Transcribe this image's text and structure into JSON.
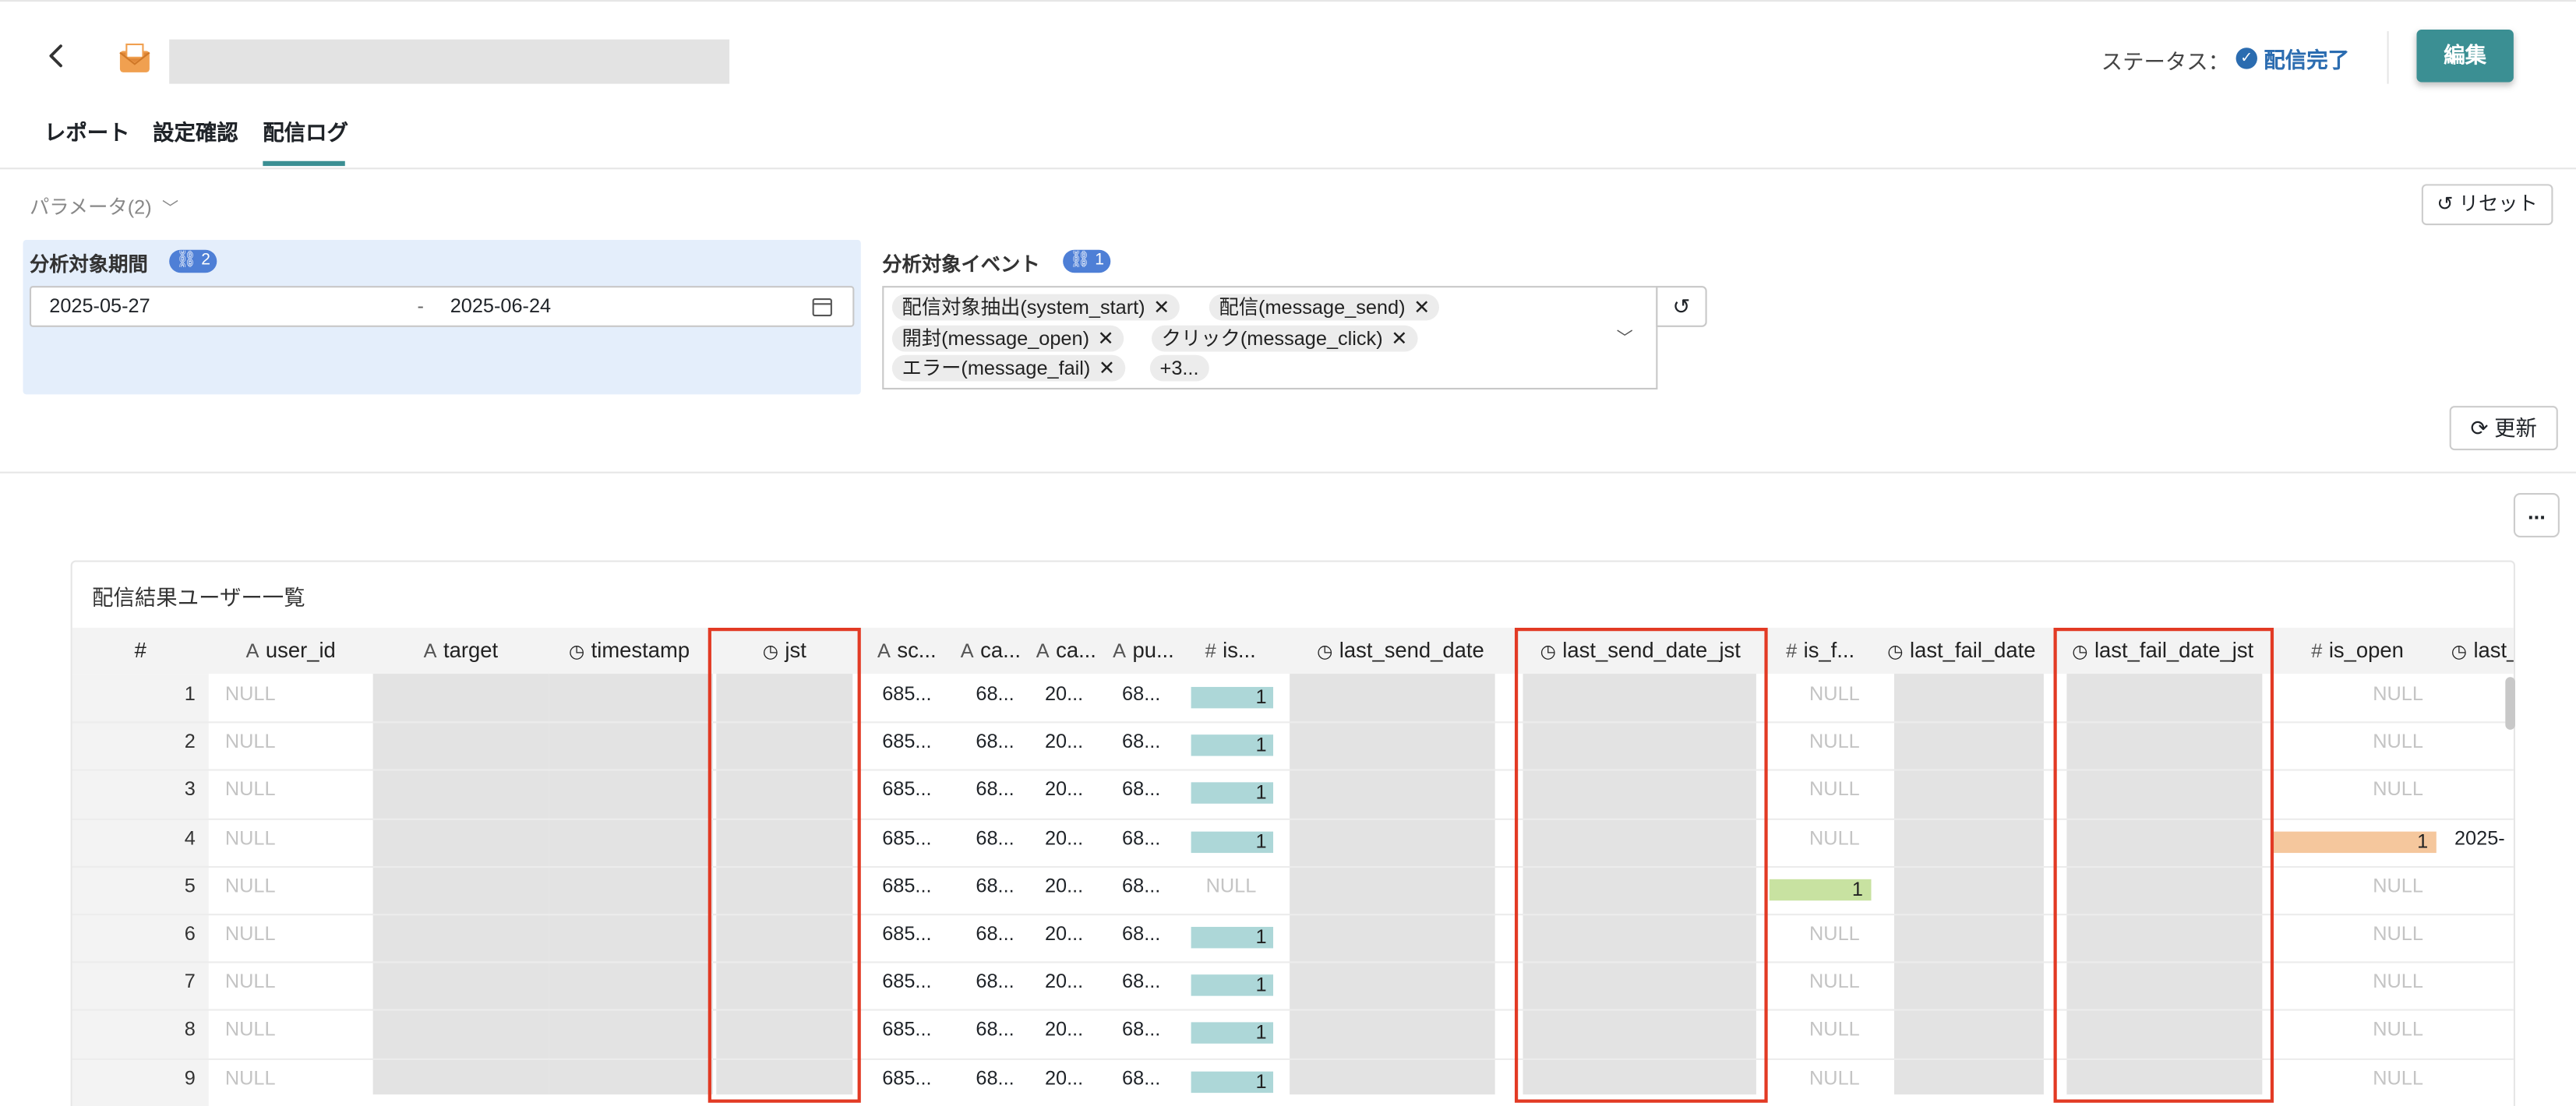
{
  "header": {
    "status_label": "ステータス：",
    "status_value": "配信完了",
    "edit_button": "編集",
    "icons": {
      "back": "chevron-left-icon",
      "mail": "envelope-icon",
      "status": "check-circle-icon"
    }
  },
  "tabs": [
    "レポート",
    "設定確認",
    "配信ログ"
  ],
  "active_tab": "配信ログ",
  "params": {
    "toggle_label": "パラメータ(2)",
    "reset_label": "リセット",
    "period": {
      "label": "分析対象期間",
      "badge": "2",
      "start": "2025-05-27",
      "separator": "-",
      "end": "2025-06-24"
    },
    "events": {
      "label": "分析対象イベント",
      "badge": "1",
      "chips": [
        "配信対象抽出(system_start)",
        "配信(message_send)",
        "開封(message_open)",
        "クリック(message_click)",
        "エラー(message_fail)"
      ],
      "more": "+3..."
    },
    "update_label": "更新",
    "more_label": "..."
  },
  "table": {
    "title": "配信結果ユーザー一覧",
    "columns": [
      {
        "type": "",
        "label": "#"
      },
      {
        "type": "A",
        "label": "user_id"
      },
      {
        "type": "A",
        "label": "target"
      },
      {
        "type": "clock",
        "label": "timestamp"
      },
      {
        "type": "clock",
        "label": "jst"
      },
      {
        "type": "A",
        "label": "sc..."
      },
      {
        "type": "A",
        "label": "ca..."
      },
      {
        "type": "A",
        "label": "ca..."
      },
      {
        "type": "A",
        "label": "pu..."
      },
      {
        "type": "#",
        "label": "is..."
      },
      {
        "type": "clock",
        "label": "last_send_date"
      },
      {
        "type": "clock",
        "label": "last_send_date_jst"
      },
      {
        "type": "#",
        "label": "is_f..."
      },
      {
        "type": "clock",
        "label": "last_fail_date"
      },
      {
        "type": "clock",
        "label": "last_fail_date_jst"
      },
      {
        "type": "#",
        "label": "is_open"
      },
      {
        "type": "clock",
        "label": "last_"
      }
    ],
    "rows": [
      {
        "n": "1",
        "user_id": "NULL",
        "sc": "685...",
        "ca1": "68...",
        "ca2": "20...",
        "pu": "68...",
        "is_send": "1",
        "is_fail": "NULL",
        "is_open": "NULL",
        "last": ""
      },
      {
        "n": "2",
        "user_id": "NULL",
        "sc": "685...",
        "ca1": "68...",
        "ca2": "20...",
        "pu": "68...",
        "is_send": "1",
        "is_fail": "NULL",
        "is_open": "NULL",
        "last": ""
      },
      {
        "n": "3",
        "user_id": "NULL",
        "sc": "685...",
        "ca1": "68...",
        "ca2": "20...",
        "pu": "68...",
        "is_send": "1",
        "is_fail": "NULL",
        "is_open": "NULL",
        "last": ""
      },
      {
        "n": "4",
        "user_id": "NULL",
        "sc": "685...",
        "ca1": "68...",
        "ca2": "20...",
        "pu": "68...",
        "is_send": "1",
        "is_fail": "NULL",
        "is_open": "1",
        "last": "2025-"
      },
      {
        "n": "5",
        "user_id": "NULL",
        "sc": "685...",
        "ca1": "68...",
        "ca2": "20...",
        "pu": "68...",
        "is_send": "NULL",
        "is_fail": "1",
        "is_open": "NULL",
        "last": ""
      },
      {
        "n": "6",
        "user_id": "NULL",
        "sc": "685...",
        "ca1": "68...",
        "ca2": "20...",
        "pu": "68...",
        "is_send": "1",
        "is_fail": "NULL",
        "is_open": "NULL",
        "last": ""
      },
      {
        "n": "7",
        "user_id": "NULL",
        "sc": "685...",
        "ca1": "68...",
        "ca2": "20...",
        "pu": "68...",
        "is_send": "1",
        "is_fail": "NULL",
        "is_open": "NULL",
        "last": ""
      },
      {
        "n": "8",
        "user_id": "NULL",
        "sc": "685...",
        "ca1": "68...",
        "ca2": "20...",
        "pu": "68...",
        "is_send": "1",
        "is_fail": "NULL",
        "is_open": "NULL",
        "last": ""
      },
      {
        "n": "9",
        "user_id": "NULL",
        "sc": "685...",
        "ca1": "68...",
        "ca2": "20...",
        "pu": "68...",
        "is_send": "1",
        "is_fail": "NULL",
        "is_open": "NULL",
        "last": ""
      }
    ],
    "colors": {
      "is_send": "#add7d8",
      "is_fail": "#c8e2a1",
      "is_open": "#f5c79d",
      "highlight": "#e23a24",
      "accent": "#3b8f93"
    }
  }
}
